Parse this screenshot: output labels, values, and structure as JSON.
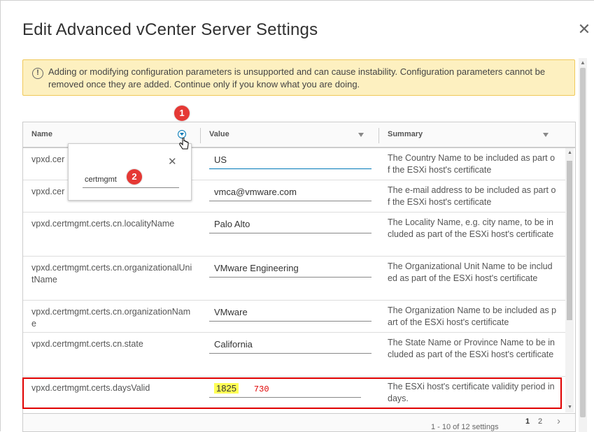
{
  "dialog": {
    "title": "Edit Advanced vCenter Server Settings",
    "close_icon": "close-icon"
  },
  "alert": {
    "icon": "info-icon",
    "text": "Adding or modifying configuration parameters is unsupported and can cause instability. Configuration parameters cannot be removed once they are added. Continue only if you know what you are doing."
  },
  "grid": {
    "columns": {
      "name": "Name",
      "value": "Value",
      "summary": "Summary"
    },
    "rows": [
      {
        "name": "vpxd.cer",
        "value": "US",
        "summary": "The Country Name to be included as part of the ESXi host's certificate"
      },
      {
        "name": "vpxd.cer",
        "value": "vmca@vmware.com",
        "summary": "The e-mail address to be included as part of the ESXi host's certificate"
      },
      {
        "name": "vpxd.certmgmt.certs.cn.localityName",
        "value": "Palo Alto",
        "summary": "The Locality Name, e.g. city name, to be included as part of the ESXi host's certificate"
      },
      {
        "name": "vpxd.certmgmt.certs.cn.organizationalUnitName",
        "value": "VMware Engineering",
        "summary": "The Organizational Unit Name to be included as part of the ESXi host's certificate"
      },
      {
        "name": "vpxd.certmgmt.certs.cn.organizationName",
        "value": "VMware",
        "summary": "The Organization Name to be included as part of the ESXi host's certificate"
      },
      {
        "name": "vpxd.certmgmt.certs.cn.state",
        "value": "California",
        "summary": "The State Name or Province Name to be included as part of the ESXi host's certificate"
      },
      {
        "name": "vpxd.certmgmt.certs.daysValid",
        "value": "1825",
        "value_new": "730",
        "summary": "The ESXi host's certificate validity period in days."
      }
    ],
    "footer": {
      "count": "1 - 10 of 12 settings",
      "page1": "1",
      "page2": "2"
    }
  },
  "filter_popup": {
    "input_value": "certmgmt"
  },
  "annotations": {
    "badge1": "1",
    "badge2": "2"
  },
  "colors": {
    "accent": "#0079b8",
    "alert_bg": "#fdf0c0",
    "highlight": "#e00000",
    "badge": "#e53935"
  }
}
